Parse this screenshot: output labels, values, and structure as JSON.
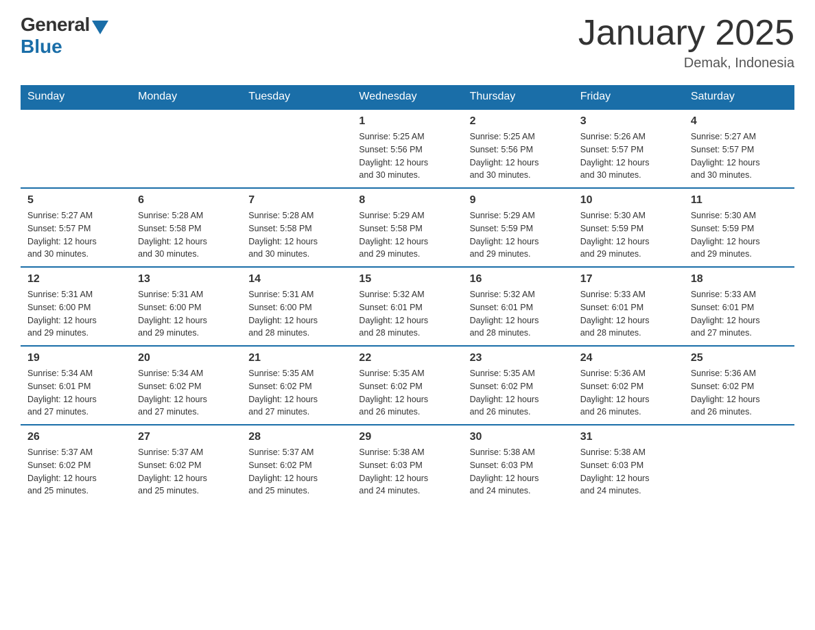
{
  "header": {
    "logo_general": "General",
    "logo_blue": "Blue",
    "title": "January 2025",
    "subtitle": "Demak, Indonesia"
  },
  "days_of_week": [
    "Sunday",
    "Monday",
    "Tuesday",
    "Wednesday",
    "Thursday",
    "Friday",
    "Saturday"
  ],
  "weeks": [
    {
      "days": [
        {
          "number": "",
          "info": ""
        },
        {
          "number": "",
          "info": ""
        },
        {
          "number": "",
          "info": ""
        },
        {
          "number": "1",
          "info": "Sunrise: 5:25 AM\nSunset: 5:56 PM\nDaylight: 12 hours\nand 30 minutes."
        },
        {
          "number": "2",
          "info": "Sunrise: 5:25 AM\nSunset: 5:56 PM\nDaylight: 12 hours\nand 30 minutes."
        },
        {
          "number": "3",
          "info": "Sunrise: 5:26 AM\nSunset: 5:57 PM\nDaylight: 12 hours\nand 30 minutes."
        },
        {
          "number": "4",
          "info": "Sunrise: 5:27 AM\nSunset: 5:57 PM\nDaylight: 12 hours\nand 30 minutes."
        }
      ]
    },
    {
      "days": [
        {
          "number": "5",
          "info": "Sunrise: 5:27 AM\nSunset: 5:57 PM\nDaylight: 12 hours\nand 30 minutes."
        },
        {
          "number": "6",
          "info": "Sunrise: 5:28 AM\nSunset: 5:58 PM\nDaylight: 12 hours\nand 30 minutes."
        },
        {
          "number": "7",
          "info": "Sunrise: 5:28 AM\nSunset: 5:58 PM\nDaylight: 12 hours\nand 30 minutes."
        },
        {
          "number": "8",
          "info": "Sunrise: 5:29 AM\nSunset: 5:58 PM\nDaylight: 12 hours\nand 29 minutes."
        },
        {
          "number": "9",
          "info": "Sunrise: 5:29 AM\nSunset: 5:59 PM\nDaylight: 12 hours\nand 29 minutes."
        },
        {
          "number": "10",
          "info": "Sunrise: 5:30 AM\nSunset: 5:59 PM\nDaylight: 12 hours\nand 29 minutes."
        },
        {
          "number": "11",
          "info": "Sunrise: 5:30 AM\nSunset: 5:59 PM\nDaylight: 12 hours\nand 29 minutes."
        }
      ]
    },
    {
      "days": [
        {
          "number": "12",
          "info": "Sunrise: 5:31 AM\nSunset: 6:00 PM\nDaylight: 12 hours\nand 29 minutes."
        },
        {
          "number": "13",
          "info": "Sunrise: 5:31 AM\nSunset: 6:00 PM\nDaylight: 12 hours\nand 29 minutes."
        },
        {
          "number": "14",
          "info": "Sunrise: 5:31 AM\nSunset: 6:00 PM\nDaylight: 12 hours\nand 28 minutes."
        },
        {
          "number": "15",
          "info": "Sunrise: 5:32 AM\nSunset: 6:01 PM\nDaylight: 12 hours\nand 28 minutes."
        },
        {
          "number": "16",
          "info": "Sunrise: 5:32 AM\nSunset: 6:01 PM\nDaylight: 12 hours\nand 28 minutes."
        },
        {
          "number": "17",
          "info": "Sunrise: 5:33 AM\nSunset: 6:01 PM\nDaylight: 12 hours\nand 28 minutes."
        },
        {
          "number": "18",
          "info": "Sunrise: 5:33 AM\nSunset: 6:01 PM\nDaylight: 12 hours\nand 27 minutes."
        }
      ]
    },
    {
      "days": [
        {
          "number": "19",
          "info": "Sunrise: 5:34 AM\nSunset: 6:01 PM\nDaylight: 12 hours\nand 27 minutes."
        },
        {
          "number": "20",
          "info": "Sunrise: 5:34 AM\nSunset: 6:02 PM\nDaylight: 12 hours\nand 27 minutes."
        },
        {
          "number": "21",
          "info": "Sunrise: 5:35 AM\nSunset: 6:02 PM\nDaylight: 12 hours\nand 27 minutes."
        },
        {
          "number": "22",
          "info": "Sunrise: 5:35 AM\nSunset: 6:02 PM\nDaylight: 12 hours\nand 26 minutes."
        },
        {
          "number": "23",
          "info": "Sunrise: 5:35 AM\nSunset: 6:02 PM\nDaylight: 12 hours\nand 26 minutes."
        },
        {
          "number": "24",
          "info": "Sunrise: 5:36 AM\nSunset: 6:02 PM\nDaylight: 12 hours\nand 26 minutes."
        },
        {
          "number": "25",
          "info": "Sunrise: 5:36 AM\nSunset: 6:02 PM\nDaylight: 12 hours\nand 26 minutes."
        }
      ]
    },
    {
      "days": [
        {
          "number": "26",
          "info": "Sunrise: 5:37 AM\nSunset: 6:02 PM\nDaylight: 12 hours\nand 25 minutes."
        },
        {
          "number": "27",
          "info": "Sunrise: 5:37 AM\nSunset: 6:02 PM\nDaylight: 12 hours\nand 25 minutes."
        },
        {
          "number": "28",
          "info": "Sunrise: 5:37 AM\nSunset: 6:02 PM\nDaylight: 12 hours\nand 25 minutes."
        },
        {
          "number": "29",
          "info": "Sunrise: 5:38 AM\nSunset: 6:03 PM\nDaylight: 12 hours\nand 24 minutes."
        },
        {
          "number": "30",
          "info": "Sunrise: 5:38 AM\nSunset: 6:03 PM\nDaylight: 12 hours\nand 24 minutes."
        },
        {
          "number": "31",
          "info": "Sunrise: 5:38 AM\nSunset: 6:03 PM\nDaylight: 12 hours\nand 24 minutes."
        },
        {
          "number": "",
          "info": ""
        }
      ]
    }
  ]
}
